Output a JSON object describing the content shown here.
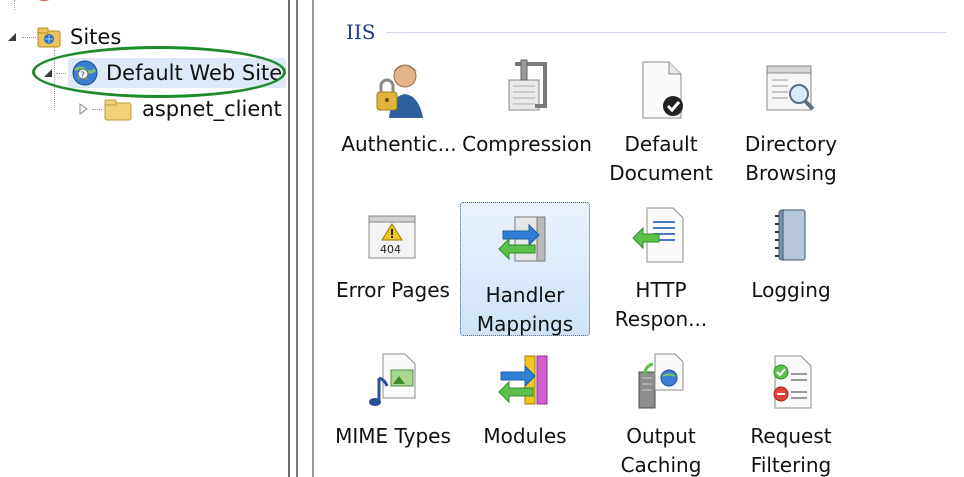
{
  "tree": {
    "sites_label": "Sites",
    "default_site_label": "Default Web Site",
    "child_label": "aspnet_client"
  },
  "features": {
    "group_title": "IIS",
    "items": [
      {
        "label": "Authentic...",
        "icon": "authentication-icon"
      },
      {
        "label": "Compression",
        "icon": "compression-icon"
      },
      {
        "label": "Default\nDocument",
        "icon": "default-document-icon"
      },
      {
        "label": "Directory\nBrowsing",
        "icon": "directory-browsing-icon"
      },
      {
        "label": "Error Pages",
        "icon": "error-pages-icon"
      },
      {
        "label": "Handler\nMappings",
        "icon": "handler-mappings-icon",
        "selected": true
      },
      {
        "label": "HTTP\nRespon...",
        "icon": "http-response-icon"
      },
      {
        "label": "Logging",
        "icon": "logging-icon"
      },
      {
        "label": "MIME Types",
        "icon": "mime-types-icon"
      },
      {
        "label": "Modules",
        "icon": "modules-icon"
      },
      {
        "label": "Output\nCaching",
        "icon": "output-caching-icon"
      },
      {
        "label": "Request\nFiltering",
        "icon": "request-filtering-icon"
      }
    ]
  },
  "colors": {
    "highlight_oval": "#1e8a2e",
    "group_title": "#1a3c8a",
    "selection_bg": "#cfe3f8"
  }
}
